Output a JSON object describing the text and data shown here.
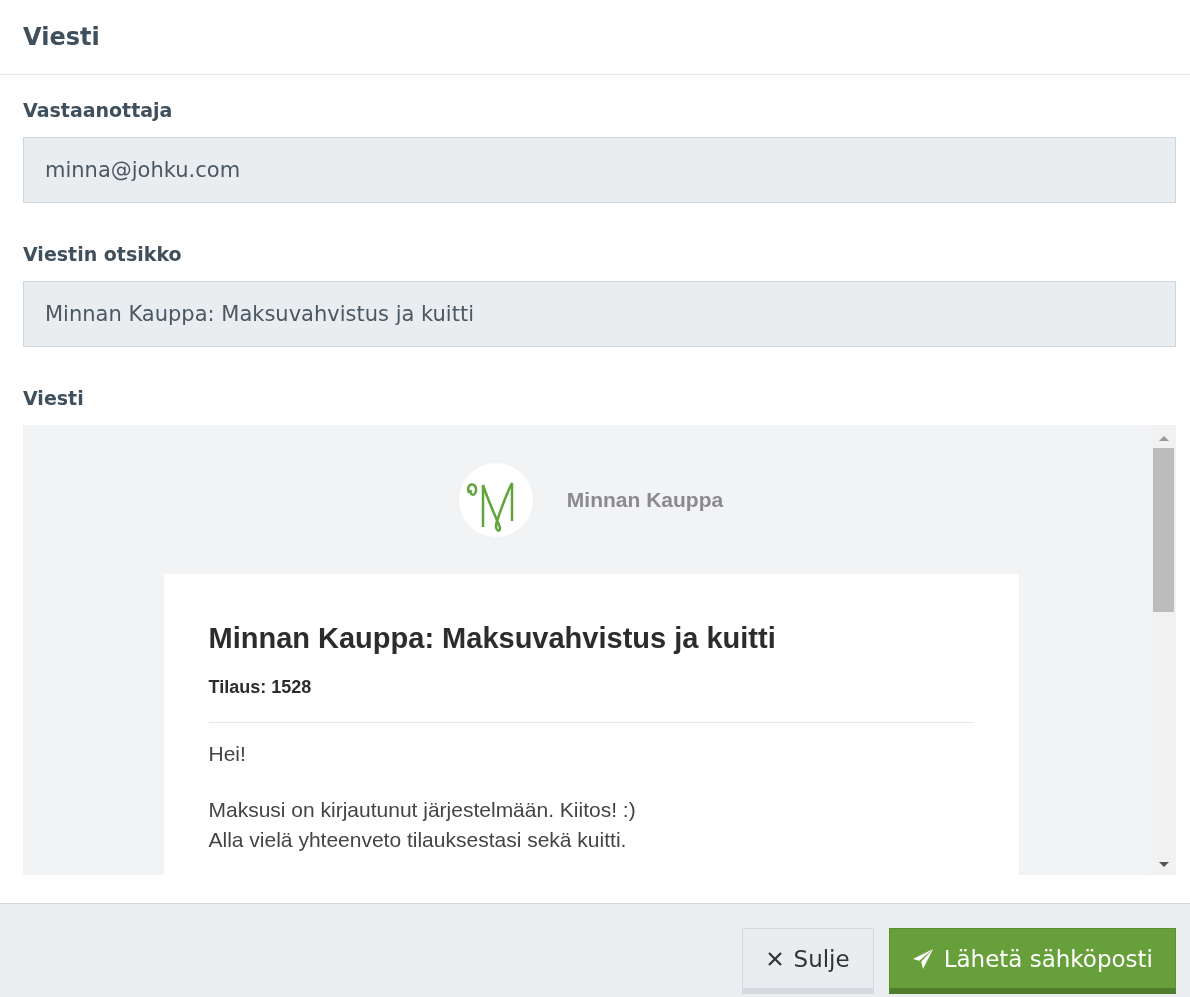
{
  "dialog": {
    "title": "Viesti"
  },
  "fields": [
    {
      "label": "Vastaanottaja",
      "value": "minna@johku.com"
    },
    {
      "label": "Viestin otsikko",
      "value": "Minnan Kauppa: Maksuvahvistus ja kuitti"
    }
  ],
  "message": {
    "label": "Viesti",
    "shop_name": "Minnan Kauppa",
    "heading": "Minnan Kauppa: Maksuvahvistus ja kuitti",
    "order": "Tilaus: 1528",
    "paragraphs": [
      [
        "Hei!"
      ],
      [
        "Maksusi on kirjautunut järjestelmään. Kiitos! :)",
        "Alla vielä yhteenveto tilauksestasi sekä kuitti."
      ]
    ]
  },
  "buttons": [
    {
      "kind": "close",
      "label": "Sulje"
    },
    {
      "kind": "send",
      "label": "Lähetä sähköposti"
    }
  ]
}
